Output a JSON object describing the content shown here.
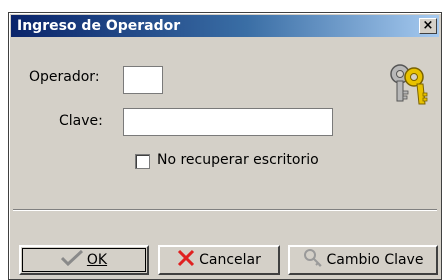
{
  "window": {
    "title": "Ingreso de Operador",
    "close_glyph": "×"
  },
  "form": {
    "operador_label": "Operador:",
    "operador_value": "",
    "clave_label": "Clave:",
    "clave_value": "",
    "no_recuperar_label": "No recuperar escritorio",
    "no_recuperar_checked": false
  },
  "icons": {
    "keys": "keys-icon",
    "ok": "checkmark-icon",
    "cancel": "x-icon",
    "change_key": "key-icon"
  },
  "buttons": {
    "ok_label": "OK",
    "cancel_label": "Cancelar",
    "cambio_label": "Cambio Clave"
  },
  "colors": {
    "title_bar": "#0a246a",
    "dialog_bg": "#d4d0c8",
    "cancel_icon": "#e02020"
  }
}
